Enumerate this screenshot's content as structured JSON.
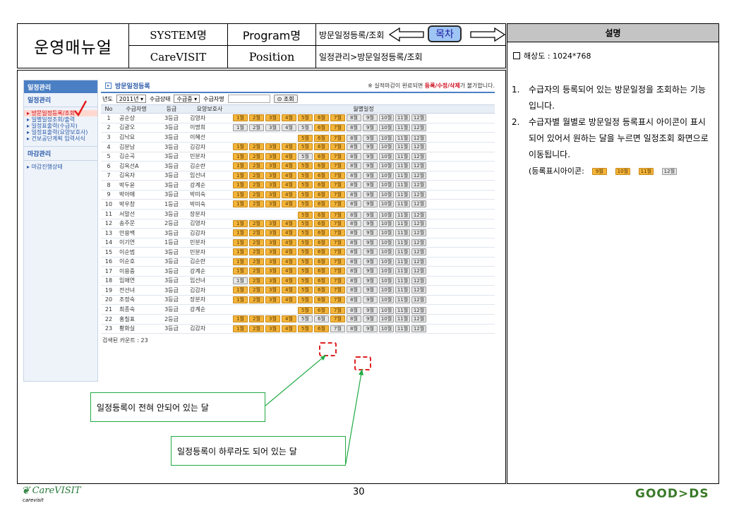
{
  "header": {
    "manual_title": "운영매뉴얼",
    "system_label": "SYSTEM명",
    "program_label": "Program명",
    "program_value": "방문일정등록/조회",
    "system_value": "CareVISIT",
    "position_label": "Position",
    "position_value": "일정관리>방문일정등록/조회",
    "toc_button": "목차"
  },
  "desc_panel": {
    "title": "설명",
    "resolution": "해상도 : 1024*768",
    "items": [
      {
        "n": "1.",
        "text": "수급자의 등록되어 있는 방문일정을 조회하는 기능입니다."
      },
      {
        "n": "2.",
        "text": "수급자별 월별로 방문일정 등록표시 아이콘이 표시되어 있어서 원하는 달을 누르면 일정조회 화면으로 이동됩니다."
      }
    ],
    "icon_label": "(등록표시아이콘:",
    "icon_months": [
      "9월",
      "10월",
      "11월",
      "12월"
    ]
  },
  "sidebar": {
    "header": "일정관리",
    "sub": "일정관리",
    "items": [
      "방문일정등록/조회",
      "일별일정조회/출력",
      "일정표출력(수급자)",
      "일정표출력(요양보호사)",
      "건보공단계획 입력서식"
    ],
    "section2": "마감관리",
    "items2": [
      "마감진행상태"
    ]
  },
  "main": {
    "title": "방문일정등록",
    "warning_pre": "※ 실적마감이 완료되면 ",
    "warning_red": "등록/수정/삭제",
    "warning_post": "가 불가합니다.",
    "filter": {
      "year_label": "년도",
      "year_value": "2011년",
      "status_label": "수급상태",
      "status_value": "수급중",
      "name_label": "수급자명",
      "search_button": "조회"
    },
    "columns": [
      "No",
      "수급자명",
      "등급",
      "요양보호사",
      "월별일정"
    ],
    "months": [
      "1월",
      "2월",
      "3월",
      "4월",
      "5월",
      "6월",
      "7월",
      "8월",
      "9월",
      "10월",
      "11월",
      "12월"
    ],
    "rows": [
      {
        "no": "1",
        "name": "공순상",
        "grade": "3등급",
        "caregiver": "김영자",
        "start": 1,
        "reg": [
          1,
          2,
          3,
          4,
          5,
          6,
          7
        ]
      },
      {
        "no": "2",
        "name": "김광오",
        "grade": "3등급",
        "caregiver": "이명희",
        "start": 1,
        "reg": [
          6,
          7
        ]
      },
      {
        "no": "3",
        "name": "김낙요",
        "grade": "3등급",
        "caregiver": "이혜선",
        "start": 5,
        "reg": [
          5,
          6,
          7
        ]
      },
      {
        "no": "4",
        "name": "김분남",
        "grade": "3등급",
        "caregiver": "김감자",
        "start": 1,
        "reg": [
          1,
          2,
          3,
          4,
          5,
          6,
          7
        ]
      },
      {
        "no": "5",
        "name": "김순곡",
        "grade": "3등급",
        "caregiver": "민분자",
        "start": 1,
        "reg": [
          1,
          2,
          3,
          4,
          6,
          7
        ]
      },
      {
        "no": "6",
        "name": "김옥선A",
        "grade": "3등급",
        "caregiver": "김순란",
        "start": 1,
        "reg": [
          1,
          2,
          3,
          4,
          5,
          6,
          7
        ]
      },
      {
        "no": "7",
        "name": "김옥자",
        "grade": "3등급",
        "caregiver": "임선녀",
        "start": 1,
        "reg": [
          1,
          2,
          3,
          4,
          5,
          6,
          7
        ]
      },
      {
        "no": "8",
        "name": "박두윤",
        "grade": "3등급",
        "caregiver": "강계순",
        "start": 1,
        "reg": [
          1,
          2,
          3,
          4,
          5,
          6,
          7
        ]
      },
      {
        "no": "9",
        "name": "박아매",
        "grade": "3등급",
        "caregiver": "박미숙",
        "start": 1,
        "reg": [
          1,
          2,
          3,
          4,
          5,
          6,
          7
        ]
      },
      {
        "no": "10",
        "name": "박우창",
        "grade": "1등급",
        "caregiver": "박미숙",
        "start": 1,
        "reg": [
          1,
          2,
          3,
          4,
          5,
          6,
          7
        ]
      },
      {
        "no": "11",
        "name": "서말선",
        "grade": "3등급",
        "caregiver": "장분자",
        "start": 5,
        "reg": [
          5,
          6,
          7
        ]
      },
      {
        "no": "12",
        "name": "송주문",
        "grade": "2등급",
        "caregiver": "김영자",
        "start": 1,
        "reg": [
          1,
          2,
          3,
          4,
          5,
          6,
          7
        ]
      },
      {
        "no": "13",
        "name": "안용백",
        "grade": "3등급",
        "caregiver": "김감자",
        "start": 1,
        "reg": [
          1,
          2,
          3,
          4,
          5,
          6,
          7
        ]
      },
      {
        "no": "14",
        "name": "이기연",
        "grade": "1등급",
        "caregiver": "민분자",
        "start": 1,
        "reg": [
          1,
          2,
          3,
          4,
          5,
          6,
          7
        ]
      },
      {
        "no": "15",
        "name": "이순범",
        "grade": "3등급",
        "caregiver": "민분자",
        "start": 1,
        "reg": [
          1,
          2,
          3,
          4,
          5,
          6,
          7
        ]
      },
      {
        "no": "16",
        "name": "이순호",
        "grade": "3등급",
        "caregiver": "김순란",
        "start": 1,
        "reg": [
          1,
          2,
          3,
          4,
          5,
          6,
          7
        ]
      },
      {
        "no": "17",
        "name": "이용중",
        "grade": "3등급",
        "caregiver": "강계순",
        "start": 1,
        "reg": [
          1,
          2,
          3,
          4,
          5,
          6,
          7
        ]
      },
      {
        "no": "18",
        "name": "임애연",
        "grade": "3등급",
        "caregiver": "임선녀",
        "start": 1,
        "reg": [
          2,
          3,
          4,
          5,
          6,
          7
        ]
      },
      {
        "no": "19",
        "name": "전선녀",
        "grade": "3등급",
        "caregiver": "김감자",
        "start": 1,
        "reg": [
          1,
          2,
          3,
          4,
          5,
          6,
          7
        ]
      },
      {
        "no": "20",
        "name": "조정숙",
        "grade": "3등급",
        "caregiver": "장분자",
        "start": 1,
        "reg": [
          1,
          2,
          3,
          4,
          5,
          6,
          7
        ]
      },
      {
        "no": "21",
        "name": "최종숙",
        "grade": "3등급",
        "caregiver": "강계순",
        "start": 5,
        "reg": [
          5,
          6,
          7
        ]
      },
      {
        "no": "22",
        "name": "홍칠표",
        "grade": "2등급",
        "caregiver": "",
        "start": 1,
        "reg": [
          1,
          2,
          3,
          4,
          7
        ]
      },
      {
        "no": "23",
        "name": "황화실",
        "grade": "3등급",
        "caregiver": "김감자",
        "start": 1,
        "reg": [
          1,
          2,
          3,
          4,
          5,
          6
        ]
      }
    ],
    "count_label": "검색된 카운트 : 23"
  },
  "callouts": {
    "none": "일정등록이 전혀 안되어 있는 달",
    "some": "일정등록이 하루라도 되어 있는 달"
  },
  "footer": {
    "page_number": "30",
    "left_logo": "CareVISIT",
    "left_logo_sub": "carevisit",
    "right_logo": "GOOD>DS"
  }
}
